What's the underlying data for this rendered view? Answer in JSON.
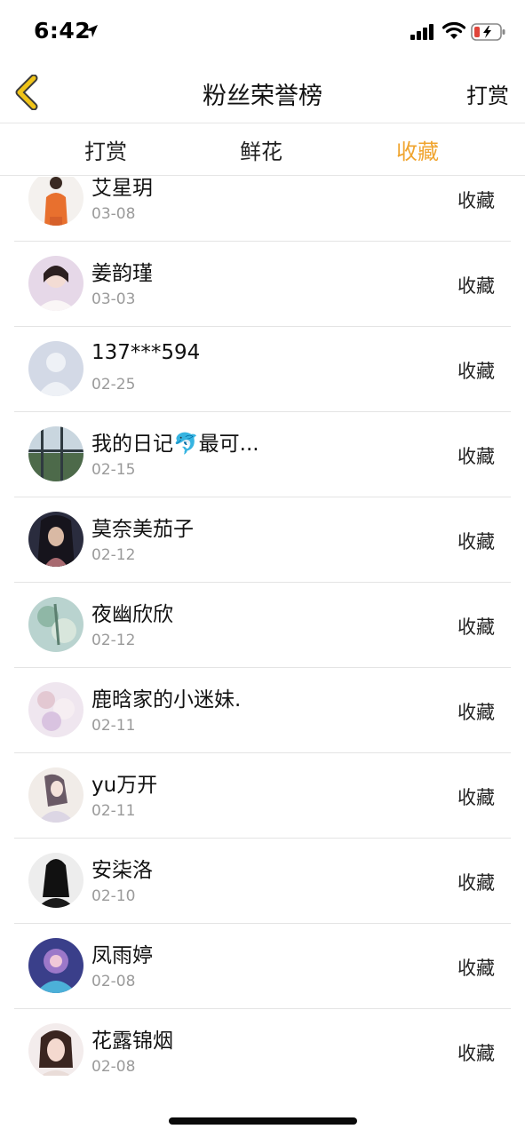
{
  "status_bar": {
    "time": "6:42",
    "battery_color": "#e0443a"
  },
  "nav": {
    "title": "粉丝荣誉榜",
    "right_label": "打赏",
    "back_icon_color": "#f0c419"
  },
  "tabs": [
    {
      "label": "打赏",
      "active": false
    },
    {
      "label": "鲜花",
      "active": false
    },
    {
      "label": "收藏",
      "active": true
    }
  ],
  "accent_color": "#f0a530",
  "fans": [
    {
      "name": "艾星玥",
      "date": "03-08",
      "action": "收藏",
      "avatar": "avatar-orange"
    },
    {
      "name": "姜韵瑾",
      "date": "03-03",
      "action": "收藏",
      "avatar": "avatar-pink"
    },
    {
      "name": "137***594",
      "date": "02-25",
      "action": "收藏",
      "avatar": "avatar-default"
    },
    {
      "name": "我的日记🐬最可...",
      "date": "02-15",
      "action": "收藏",
      "avatar": "avatar-landscape"
    },
    {
      "name": "莫奈美茄子",
      "date": "02-12",
      "action": "收藏",
      "avatar": "avatar-dark"
    },
    {
      "name": "夜幽欣欣",
      "date": "02-12",
      "action": "收藏",
      "avatar": "avatar-teal"
    },
    {
      "name": "鹿晗家的小迷妹.",
      "date": "02-11",
      "action": "收藏",
      "avatar": "avatar-lilac"
    },
    {
      "name": "yu万开",
      "date": "02-11",
      "action": "收藏",
      "avatar": "avatar-sketch"
    },
    {
      "name": "安柒洛",
      "date": "02-10",
      "action": "收藏",
      "avatar": "avatar-mono"
    },
    {
      "name": "凤雨婷",
      "date": "02-08",
      "action": "收藏",
      "avatar": "avatar-purple"
    },
    {
      "name": "花露锦烟",
      "date": "02-08",
      "action": "收藏",
      "avatar": "avatar-portrait"
    }
  ]
}
